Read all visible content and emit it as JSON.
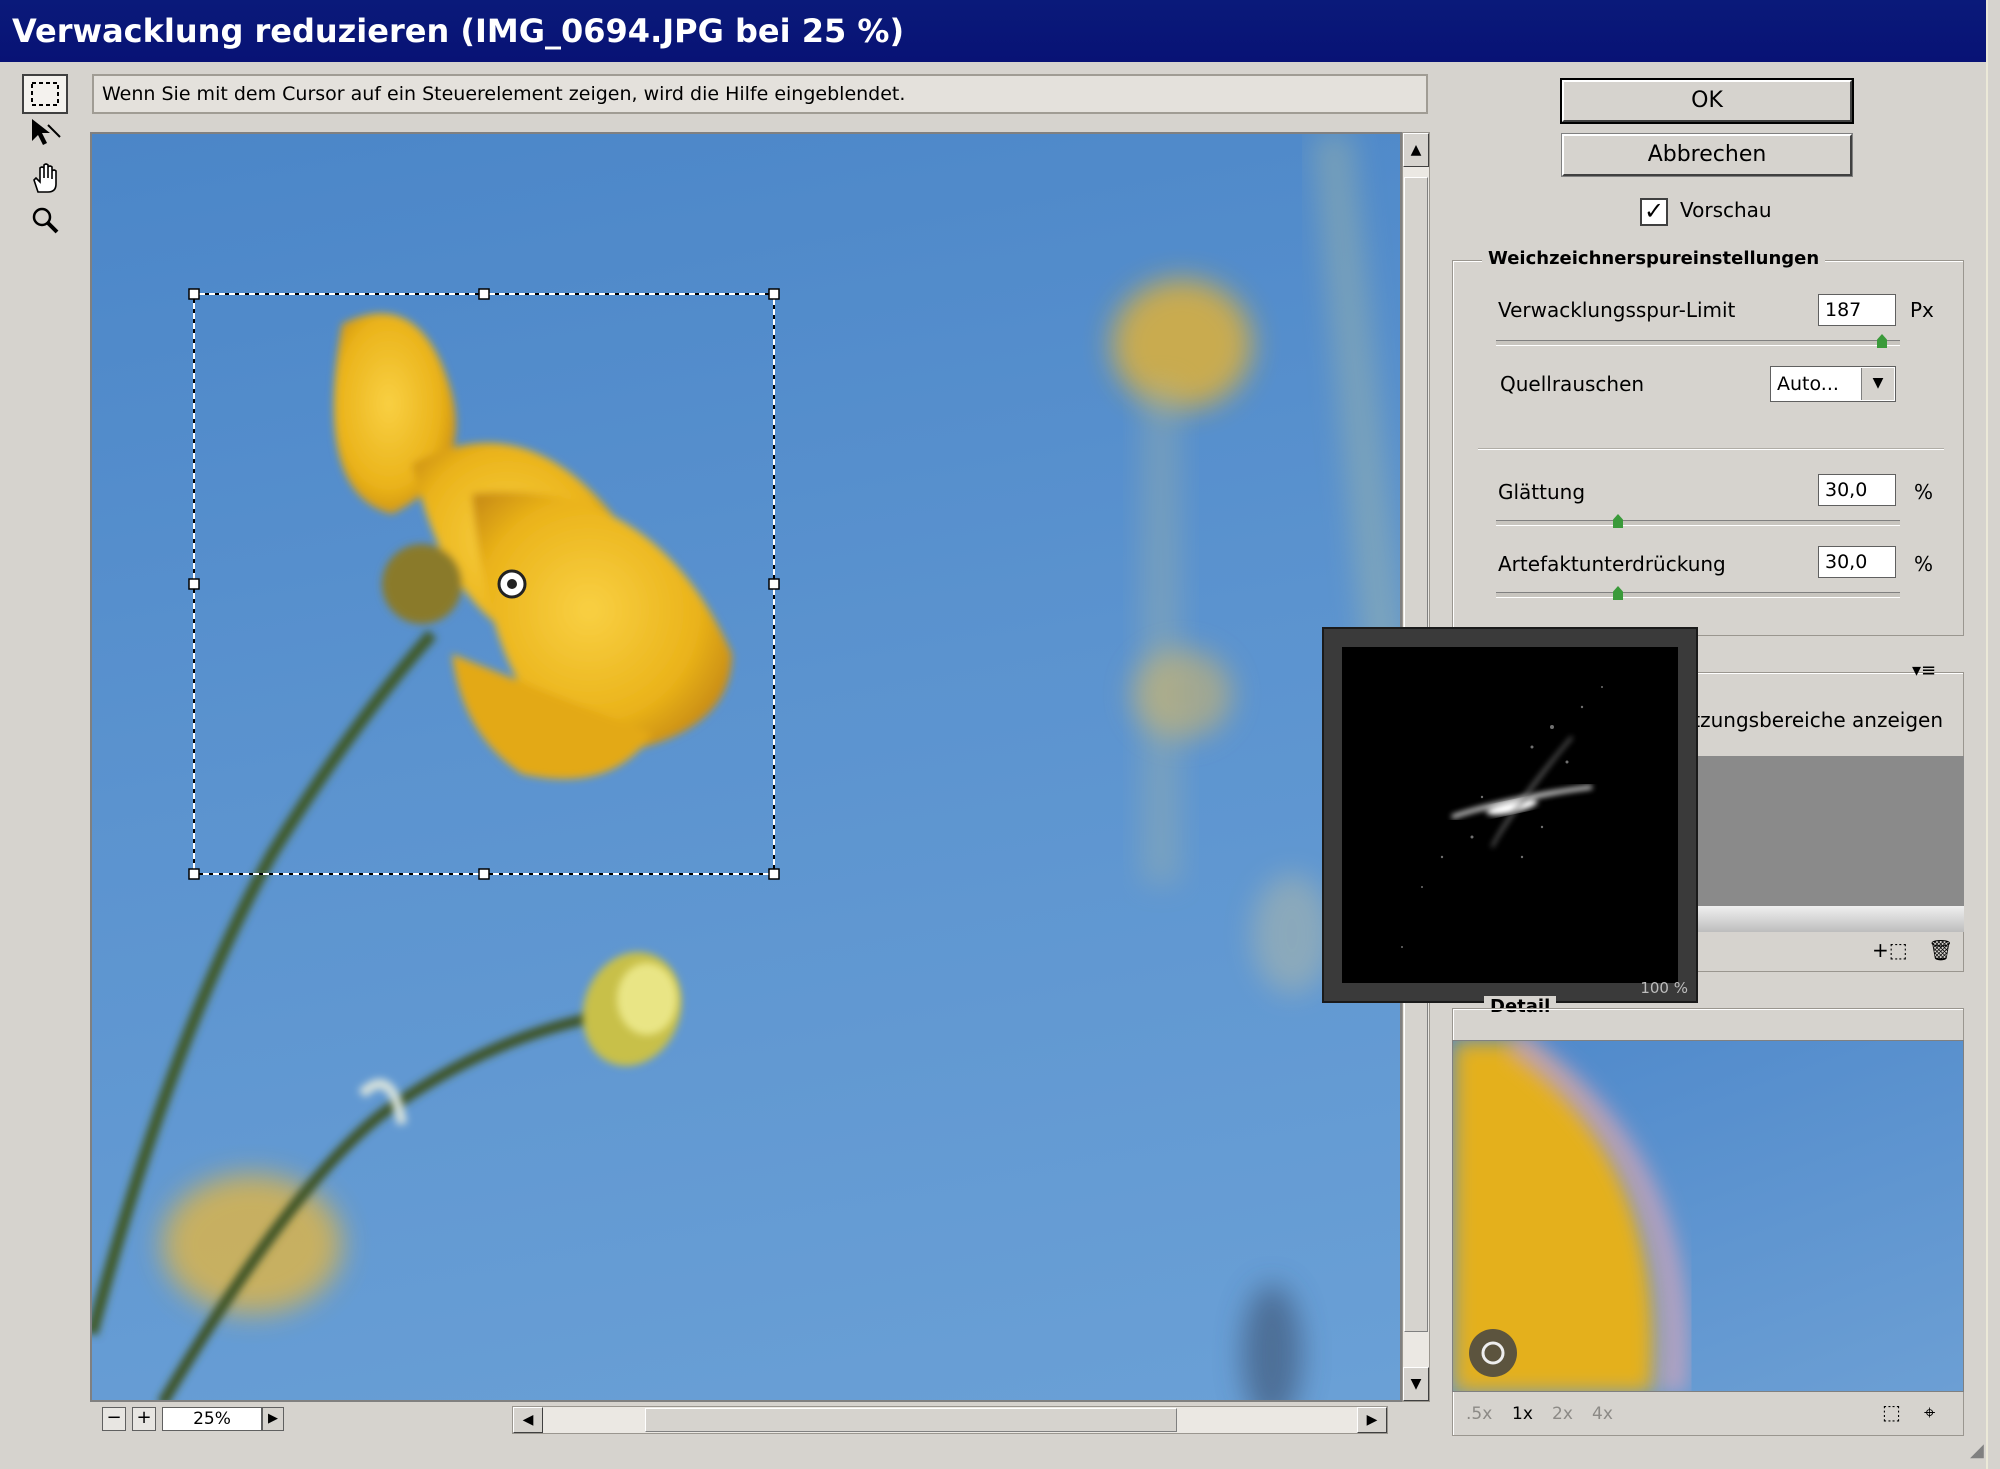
{
  "window": {
    "title": "Verwacklung reduzieren (IMG_0694.JPG bei 25 %)"
  },
  "help_text": "Wenn Sie mit dem Cursor auf ein Steuerelement zeigen, wird die Hilfe eingeblendet.",
  "tools": [
    "marquee-tool-icon",
    "direction-tool-icon",
    "hand-tool-icon",
    "zoom-tool-icon"
  ],
  "buttons": {
    "ok": "OK",
    "cancel": "Abbrechen"
  },
  "preview_toggle": {
    "label": "Vorschau",
    "checked": true
  },
  "blur_trace": {
    "group_title": "Weichzeichnerspureinstellungen",
    "limit_label": "Verwacklungsspur-Limit",
    "limit_value": "187",
    "limit_unit": "Px",
    "noise_label": "Quellrauschen",
    "noise_value": "Auto...",
    "smoothing_label": "Glättung",
    "smoothing_value": "30,0",
    "smoothing_unit": "%",
    "artifact_label": "Artefaktunterdrückung",
    "artifact_value": "30,0",
    "artifact_unit": "%"
  },
  "estimation": {
    "partial_label": "ätzungsbereiche anzeigen"
  },
  "kernel_preview": {
    "zoom": "100 %"
  },
  "detail": {
    "title": "Detail",
    "zoom_options": [
      ".5x",
      "1x",
      "2x",
      "4x"
    ],
    "selected_zoom": "1x"
  },
  "zoom_field": "25%",
  "colors": {
    "title_bar": "#0a1a7a",
    "panel": "#d6d3ce",
    "sky": "#5b93cf",
    "flower": "#f1b51c"
  }
}
